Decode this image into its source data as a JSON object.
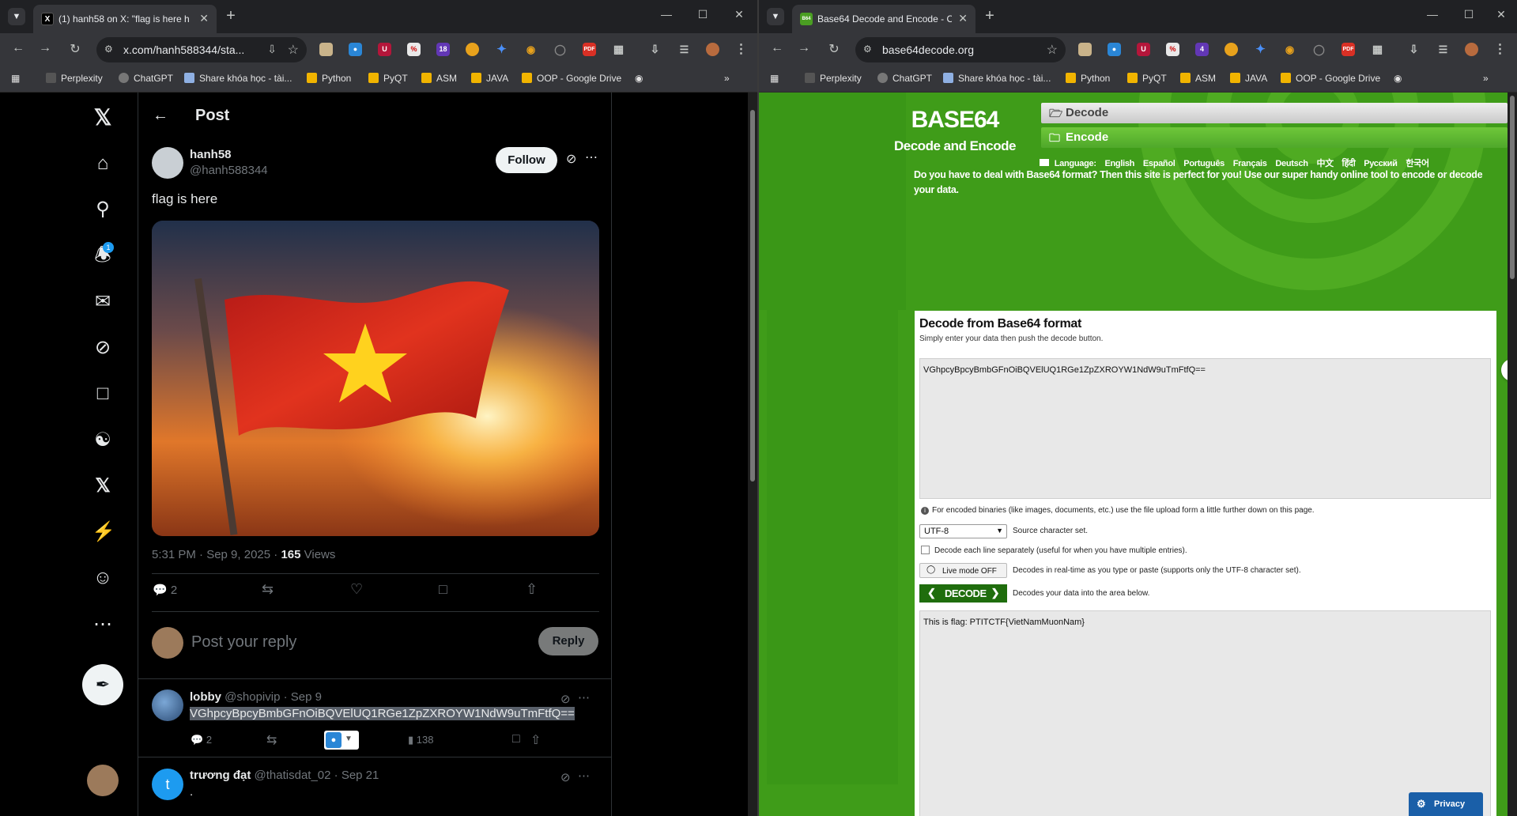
{
  "left": {
    "tab": {
      "title": "(1) hanh58 on X: \"flag is here h",
      "favicon": "X"
    },
    "omnibox": {
      "url": "x.com/hanh588344/sta..."
    },
    "bookmarks": [
      "Perplexity",
      "ChatGPT",
      "Share khóa học - tài...",
      "Python",
      "PyQT",
      "ASM",
      "JAVA",
      "OOP - Google Drive"
    ],
    "ext_badge": "18",
    "notif_badge": "1",
    "header": {
      "title": "Post"
    },
    "post": {
      "display_name": "hanh58",
      "handle": "@hanh588344",
      "follow_label": "Follow",
      "text": "flag is here",
      "timestamp": "5:31 PM · Sep 9, 2025 · ",
      "views_count": "165",
      "views_label": " Views",
      "reply_count": "2"
    },
    "reply_box": {
      "placeholder": "Post your reply",
      "button": "Reply"
    },
    "replies": [
      {
        "name": "lobby",
        "handle": "@shopivip · Sep 9",
        "text": "VGhpcyBpcyBmbGFnOiBQVElUQ1RGe1ZpZXROYW1NdW9uTmFtfQ==",
        "reply_count": "2",
        "views": "138"
      },
      {
        "name": "trương đạt",
        "handle": "@thatisdat_02 · Sep 21",
        "text": ".",
        "avatar_letter": "t"
      }
    ]
  },
  "right": {
    "tab": {
      "title": "Base64 Decode and Encode - O",
      "favicon": "B64"
    },
    "omnibox": {
      "url": "base64decode.org"
    },
    "bookmarks": [
      "Perplexity",
      "ChatGPT",
      "Share khóa học - tài...",
      "Python",
      "PyQT",
      "ASM",
      "JAVA",
      "OOP - Google Drive"
    ],
    "ext_badge": "4",
    "logo": {
      "title": "BASE64",
      "subtitle": "Decode and Encode"
    },
    "nav": {
      "decode": "Decode",
      "encode": "Encode"
    },
    "language": {
      "label": "Language:",
      "options": [
        "English",
        "Español",
        "Português",
        "Français",
        "Deutsch",
        "中文",
        "हिंदी",
        "Русский",
        "한국어"
      ]
    },
    "intro": "Do you have to deal with Base64 format? Then this site is perfect for you! Use our super handy online tool to encode or decode your data.",
    "card": {
      "title": "Decode from Base64 format",
      "subtitle": "Simply enter your data then push the decode button.",
      "input_value": "VGhpcyBpcyBmbGFnOiBQVElUQ1RGe1ZpZXROYW1NdW9uTmFtfQ==",
      "binaries_note": "For encoded binaries (like images, documents, etc.) use the file upload form a little further down on this page.",
      "charset_value": "UTF-8",
      "charset_label": "Source character set.",
      "each_line_label": "Decode each line separately (useful for when you have multiple entries).",
      "live_mode_label": "Live mode OFF",
      "live_mode_desc": "Decodes in real-time as you type or paste (supports only the UTF-8 character set).",
      "decode_button": "DECODE",
      "decode_desc": "Decodes your data into the area below.",
      "output_value": "This is flag: PTITCTF{VietNamMuonNam}"
    },
    "privacy_label": "Privacy"
  }
}
